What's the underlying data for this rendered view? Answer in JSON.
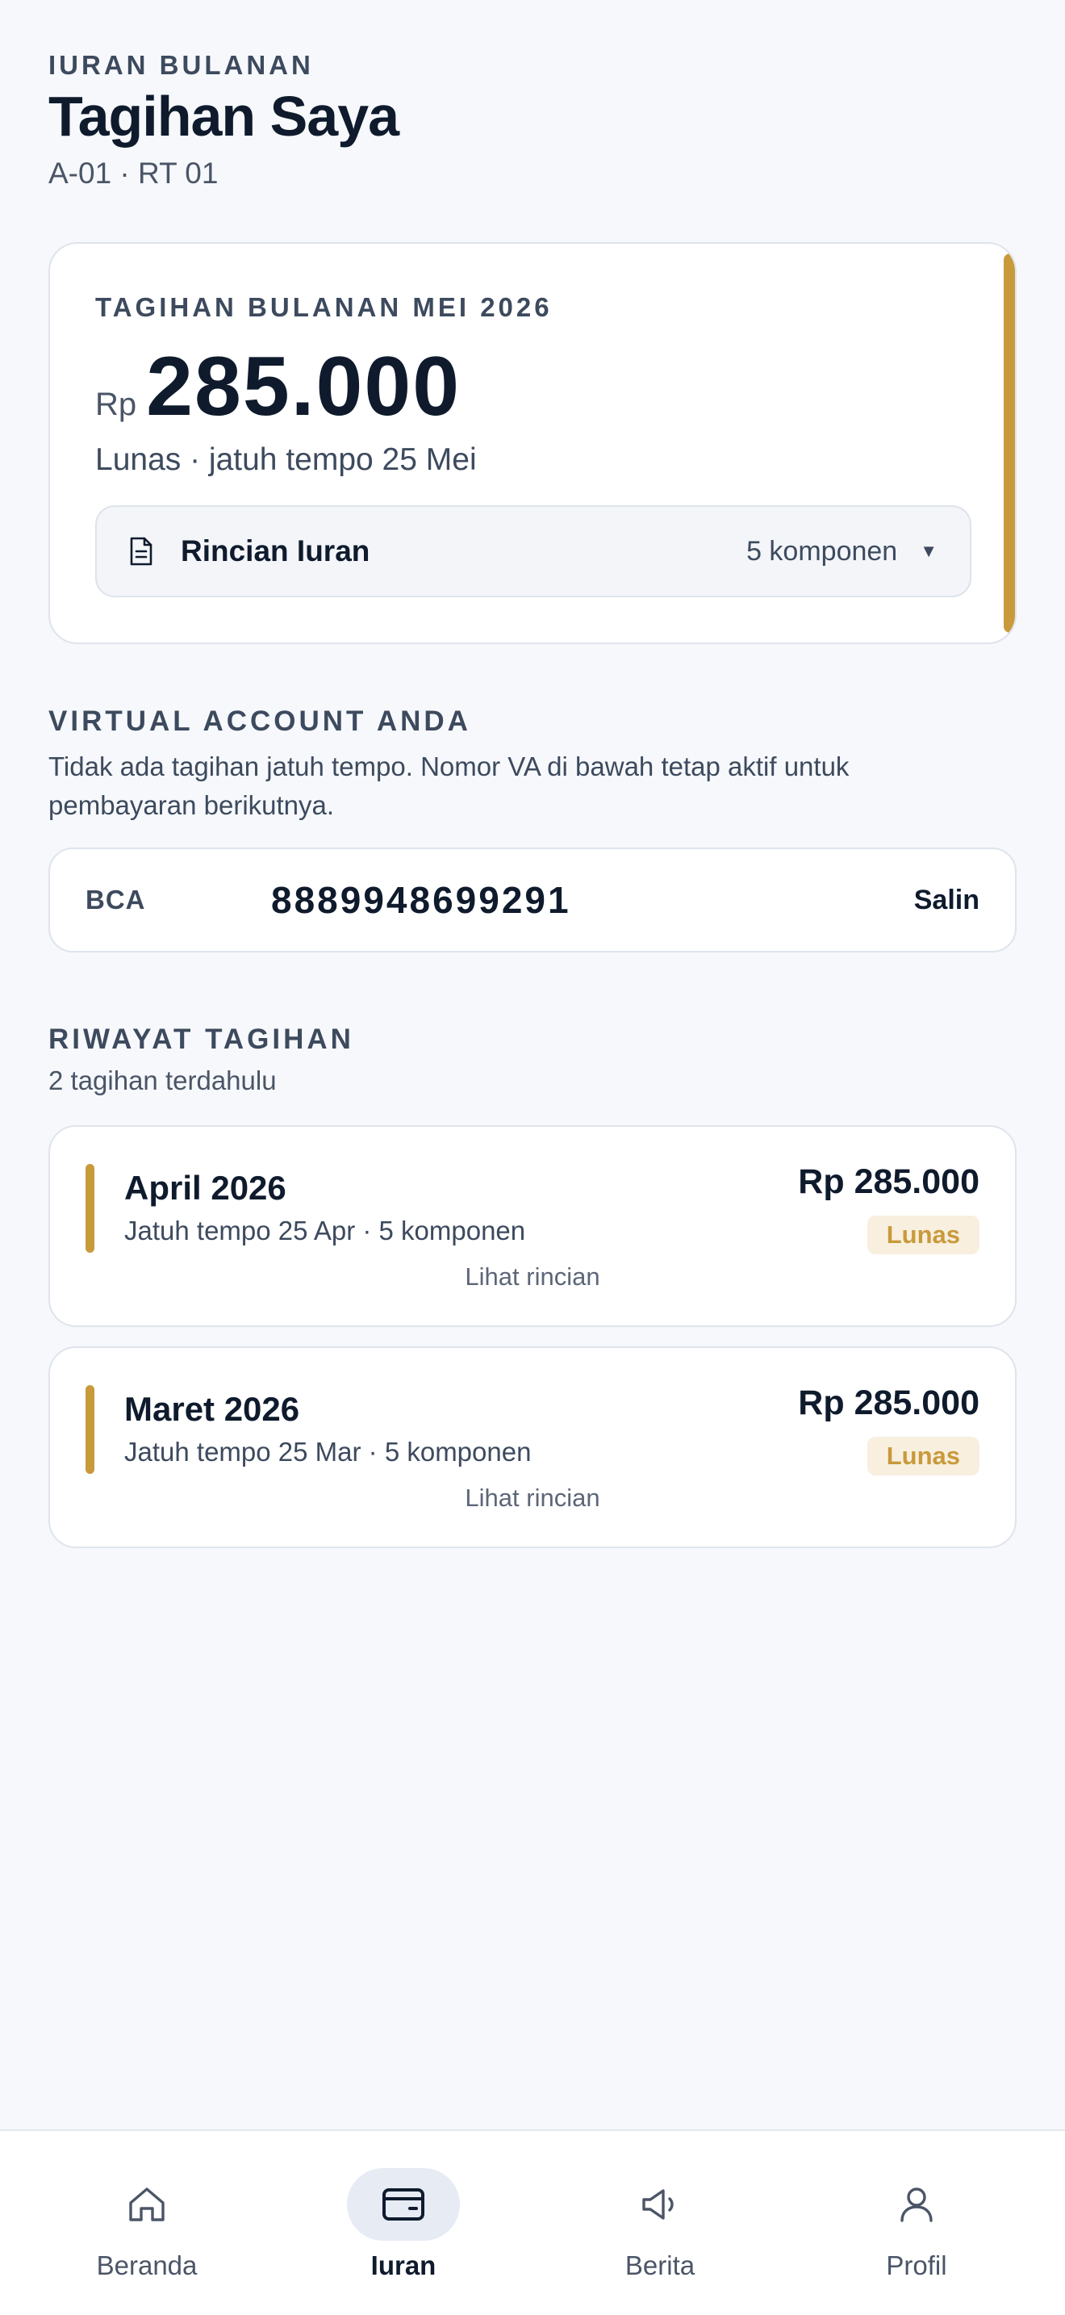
{
  "header": {
    "eyebrow": "IURAN BULANAN",
    "title": "Tagihan Saya",
    "subtitle": "A-01 · RT 01"
  },
  "current_bill": {
    "label": "TAGIHAN BULANAN MEI 2026",
    "currency": "Rp",
    "amount": "285.000",
    "status": "Lunas · jatuh tempo 25 Mei",
    "detail_title": "Rincian Iuran",
    "detail_count": "5 komponen",
    "accent_color": "#c99a3b"
  },
  "virtual_account": {
    "section_label": "VIRTUAL ACCOUNT ANDA",
    "note": "Tidak ada tagihan jatuh tempo. Nomor VA di bawah tetap aktif untuk pembayaran berikutnya.",
    "bank": "BCA",
    "number": "8889948699291",
    "copy_label": "Salin"
  },
  "history": {
    "section_label": "RIWAYAT TAGIHAN",
    "subtitle": "2 tagihan terdahulu",
    "items": [
      {
        "month": "April 2026",
        "meta": "Jatuh tempo 25 Apr · 5 komponen",
        "amount": "Rp 285.000",
        "status": "Lunas",
        "link": "Lihat rincian"
      },
      {
        "month": "Maret 2026",
        "meta": "Jatuh tempo 25 Mar · 5 komponen",
        "amount": "Rp 285.000",
        "status": "Lunas",
        "link": "Lihat rincian"
      }
    ]
  },
  "nav": {
    "items": [
      {
        "label": "Beranda",
        "icon": "home-icon"
      },
      {
        "label": "Iuran",
        "icon": "wallet-icon",
        "active": true
      },
      {
        "label": "Berita",
        "icon": "megaphone-icon"
      },
      {
        "label": "Profil",
        "icon": "user-icon"
      }
    ]
  }
}
